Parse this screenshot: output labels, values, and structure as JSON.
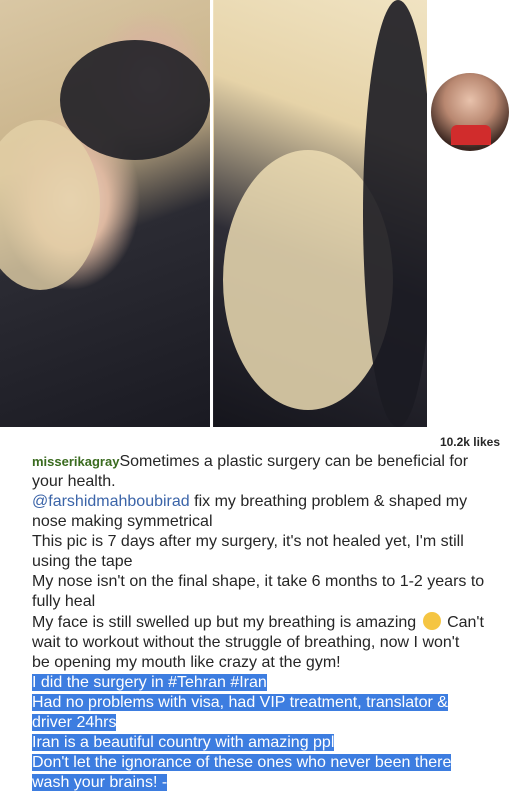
{
  "post": {
    "likes": "10.2k likes",
    "username": "misserikagray",
    "caption_lines": [
      "Sometimes a plastic surgery can be beneficial for",
      "your health.",
      "@farshidmahboubirad",
      " fix my breathing problem & shaped my",
      "nose making symmetrical",
      "This pic is 7 days after my surgery, it's not healed yet, I'm still",
      "using the tape",
      "My nose isn't on the final shape, it take 6 months to 1-2 years to",
      "fully heal",
      "My face is still swelled up but my breathing is amazing",
      " Can't",
      "wait to workout without the struggle of breathing, now I won't",
      "be opening my mouth like crazy at the gym!",
      "I did the surgery in #Tehran #Iran",
      "Had no problems with visa, had VIP treatment, translator &",
      "driver 24hrs",
      "Iran is a beautiful country with amazing ppl",
      "Don't let the ignorance of these ones who never been there",
      "wash your brains! -"
    ],
    "emoji_icon": "raised-hands-emoji-icon"
  }
}
